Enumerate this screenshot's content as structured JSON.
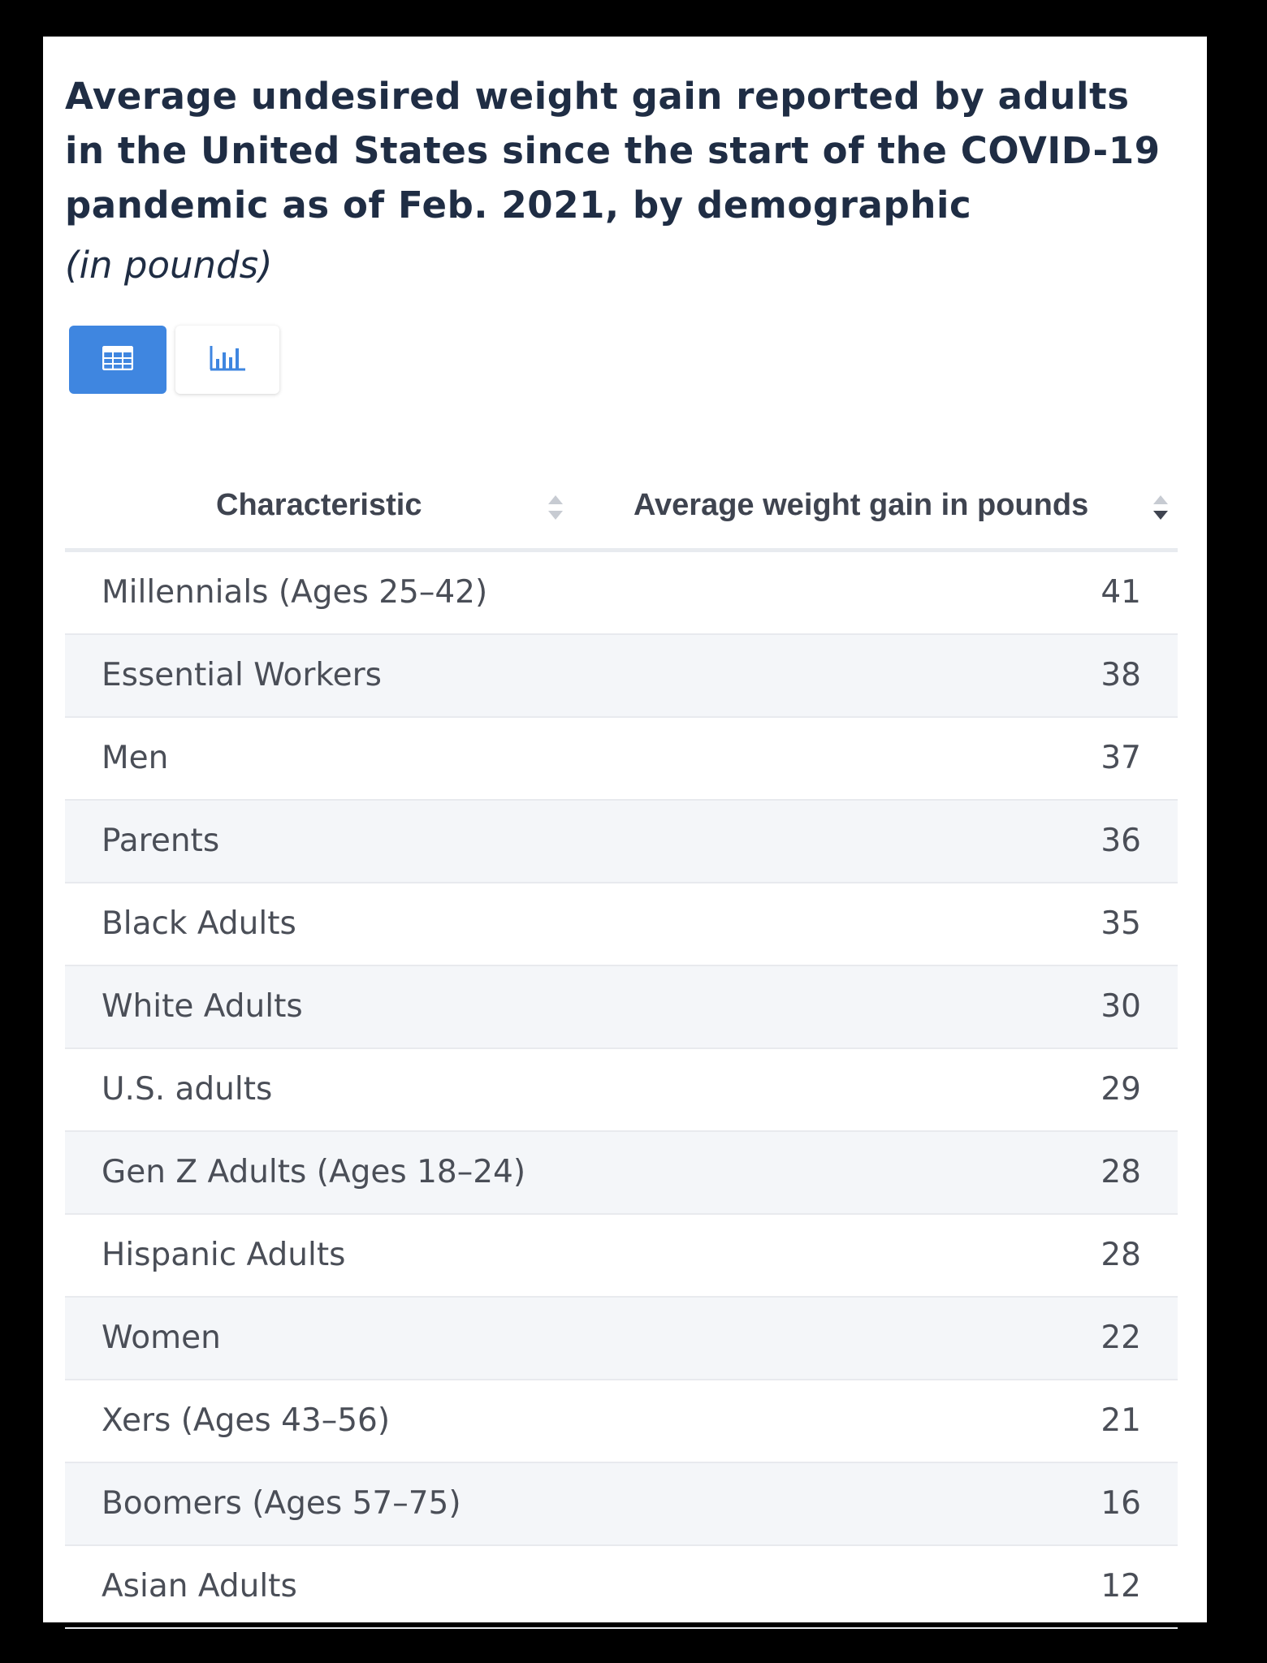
{
  "title": "Average undesired weight gain reported by adults in the United States since the start of the COVID-19 pandemic as of Feb. 2021, by demographic",
  "subtitle": "(in pounds)",
  "view_toggle": {
    "table_icon": "table-grid-icon",
    "chart_icon": "bar-chart-icon",
    "active": "table",
    "active_color": "#3f86e0"
  },
  "table": {
    "headers": [
      "Characteristic",
      "Average weight gain in pounds"
    ],
    "sorted_column": "Average weight gain in pounds",
    "sort_direction": "descending"
  },
  "chart_data": {
    "type": "table",
    "title": "Average undesired weight gain reported by adults in the United States since the start of the COVID-19 pandemic as of Feb. 2021, by demographic",
    "subtitle": "(in pounds)",
    "columns": [
      "Characteristic",
      "Average weight gain in pounds"
    ],
    "categories": [
      "Millennials (Ages 25–42)",
      "Essential Workers",
      "Men",
      "Parents",
      "Black Adults",
      "White Adults",
      "U.S. adults",
      "Gen Z Adults (Ages 18–24)",
      "Hispanic Adults",
      "Women",
      "Xers (Ages 43–56)",
      "Boomers (Ages 57–75)",
      "Asian Adults"
    ],
    "values": [
      41,
      38,
      37,
      36,
      35,
      30,
      29,
      28,
      28,
      22,
      21,
      16,
      12
    ]
  }
}
